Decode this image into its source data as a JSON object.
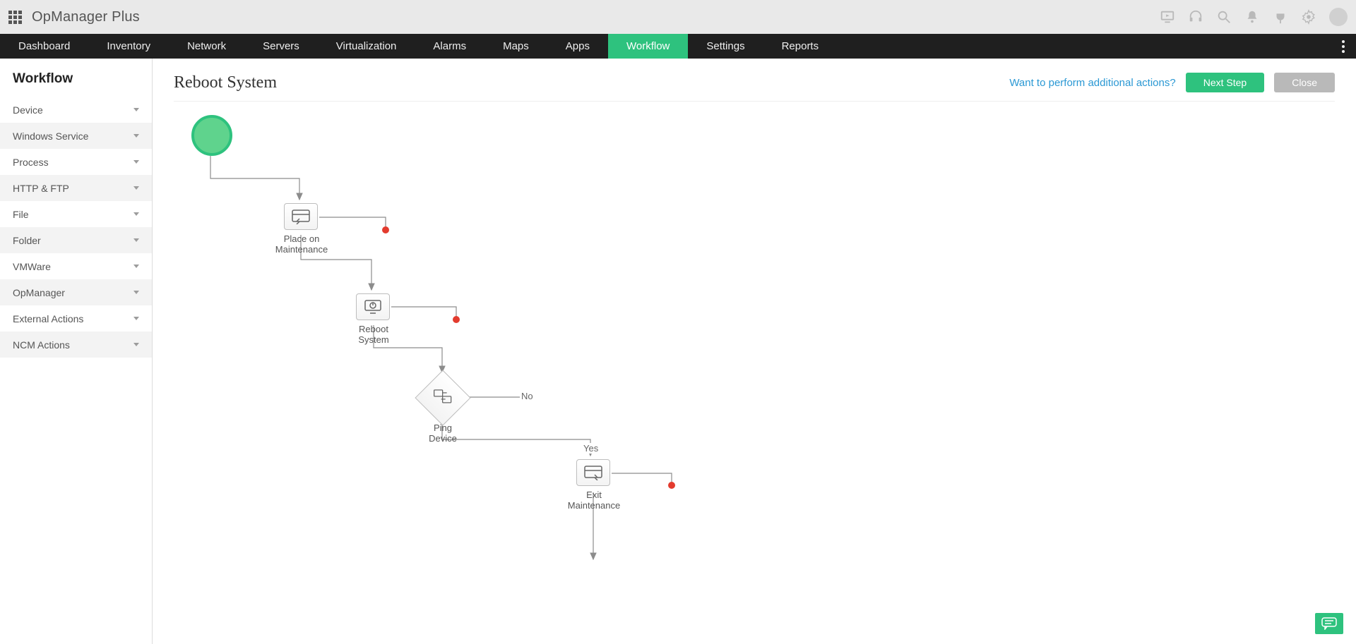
{
  "brand": "OpManager Plus",
  "nav": {
    "items": [
      {
        "label": "Dashboard",
        "active": false
      },
      {
        "label": "Inventory",
        "active": false
      },
      {
        "label": "Network",
        "active": false
      },
      {
        "label": "Servers",
        "active": false
      },
      {
        "label": "Virtualization",
        "active": false
      },
      {
        "label": "Alarms",
        "active": false
      },
      {
        "label": "Maps",
        "active": false
      },
      {
        "label": "Apps",
        "active": false
      },
      {
        "label": "Workflow",
        "active": true
      },
      {
        "label": "Settings",
        "active": false
      },
      {
        "label": "Reports",
        "active": false
      }
    ]
  },
  "sidebar": {
    "title": "Workflow",
    "items": [
      {
        "label": "Device"
      },
      {
        "label": "Windows Service"
      },
      {
        "label": "Process"
      },
      {
        "label": "HTTP & FTP"
      },
      {
        "label": "File"
      },
      {
        "label": "Folder"
      },
      {
        "label": "VMWare"
      },
      {
        "label": "OpManager"
      },
      {
        "label": "External Actions"
      },
      {
        "label": "NCM Actions"
      }
    ]
  },
  "page": {
    "title": "Reboot System",
    "additional_link": "Want to perform additional actions?",
    "next_button": "Next Step",
    "close_button": "Close"
  },
  "flow": {
    "nodes": {
      "start": {
        "type": "start"
      },
      "n1": {
        "label": "Place on\nMaintenance"
      },
      "n2": {
        "label": "Reboot\nSystem"
      },
      "n3": {
        "type": "decision",
        "label": "Ping\nDevice"
      },
      "n4": {
        "label": "Exit\nMaintenance"
      }
    },
    "edges": {
      "no_label": "No",
      "yes_label": "Yes"
    }
  }
}
